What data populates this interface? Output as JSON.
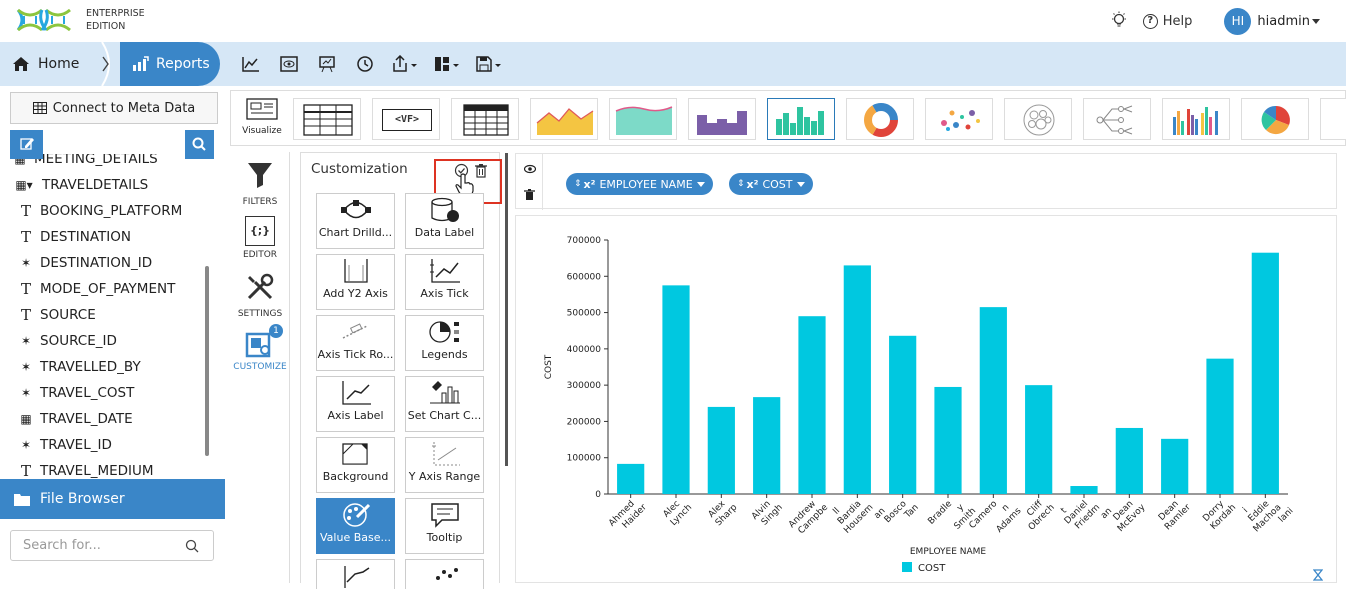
{
  "brand": {
    "edition_line1": "ENTERPRISE",
    "edition_line2": "EDITION"
  },
  "header": {
    "help_label": "Help",
    "avatar_initials": "HI",
    "username": "hiadmin"
  },
  "breadcrumb": {
    "home_label": "Home",
    "reports_label": "Reports"
  },
  "left_panel": {
    "connect_label": "Connect to Meta Data",
    "tree": [
      {
        "icon": "table-icon",
        "label": "MEETING_DETAILS"
      },
      {
        "icon": "table-icon",
        "label": "TRAVELDETAILS"
      },
      {
        "icon": "text-icon",
        "label": "BOOKING_PLATFORM"
      },
      {
        "icon": "text-icon",
        "label": "DESTINATION"
      },
      {
        "icon": "number-icon",
        "label": "DESTINATION_ID"
      },
      {
        "icon": "text-icon",
        "label": "MODE_OF_PAYMENT"
      },
      {
        "icon": "text-icon",
        "label": "SOURCE"
      },
      {
        "icon": "number-icon",
        "label": "SOURCE_ID"
      },
      {
        "icon": "number-icon",
        "label": "TRAVELLED_BY"
      },
      {
        "icon": "number-icon",
        "label": "TRAVEL_COST"
      },
      {
        "icon": "calendar-icon",
        "label": "TRAVEL_DATE"
      },
      {
        "icon": "number-icon",
        "label": "TRAVEL_ID"
      },
      {
        "icon": "text-icon",
        "label": "TRAVEL_MEDIUM"
      }
    ],
    "file_browser_label": "File Browser",
    "search_placeholder": "Search for..."
  },
  "viz_bar": {
    "visualize_label": "Visualize",
    "vf_label": "<VF>"
  },
  "side_tools": {
    "filters": "FILTERS",
    "editor": "EDITOR",
    "editor_glyph": "{;}",
    "settings": "SETTINGS",
    "customize": "CUSTOMIZE",
    "customize_badge": "1"
  },
  "customization": {
    "title": "Customization",
    "cards": [
      "Chart Drilld...",
      "Data Label",
      "Add Y2 Axis",
      "Axis Tick",
      "Axis Tick Ro...",
      "Legends",
      "Axis Label",
      "Set Chart C...",
      "Background",
      "Y Axis Range",
      "Value Base...",
      "Tooltip"
    ]
  },
  "fields": {
    "x_field": "EMPLOYEE NAME",
    "y_field": "COST"
  },
  "colors": {
    "accent": "#3a86c8",
    "bar": "#00c8e0",
    "nav_bg": "#d6e7f6"
  },
  "chart_data": {
    "type": "bar",
    "xlabel": "EMPLOYEE NAME",
    "ylabel": "COST",
    "ylim": [
      0,
      700000
    ],
    "yticks": [
      "0",
      "100000",
      "200000",
      "300000",
      "400000",
      "500000",
      "600000",
      "700000"
    ],
    "categories": [
      [
        "Ahmed",
        "Haider"
      ],
      [
        "Alec",
        "Lynch"
      ],
      [
        "Alex",
        "Sharp"
      ],
      [
        "Alvin",
        "Singh"
      ],
      [
        "Andrew",
        "Campbe",
        "ll"
      ],
      [
        "Bardia",
        "Housem",
        "an"
      ],
      [
        "Bosco",
        "Tan"
      ],
      [
        "Bradle",
        "y",
        "Smith"
      ],
      [
        "Camero",
        "n",
        "Adams"
      ],
      [
        "Cliff",
        "Obrech",
        "t"
      ],
      [
        "Daniel",
        "Friedm",
        "an"
      ],
      [
        "Dean",
        "McEvoy"
      ],
      [
        "Dean",
        "Ramler"
      ],
      [
        "Dorry",
        "Kordah",
        "i"
      ],
      [
        "Eddie",
        "Machoa",
        "lani"
      ]
    ],
    "series": [
      {
        "name": "COST",
        "values": [
          83000,
          575000,
          240000,
          267000,
          490000,
          630000,
          436000,
          295000,
          515000,
          300000,
          22000,
          182000,
          152000,
          373000,
          665000
        ]
      }
    ],
    "legend": "bottom-center",
    "grid": false
  }
}
